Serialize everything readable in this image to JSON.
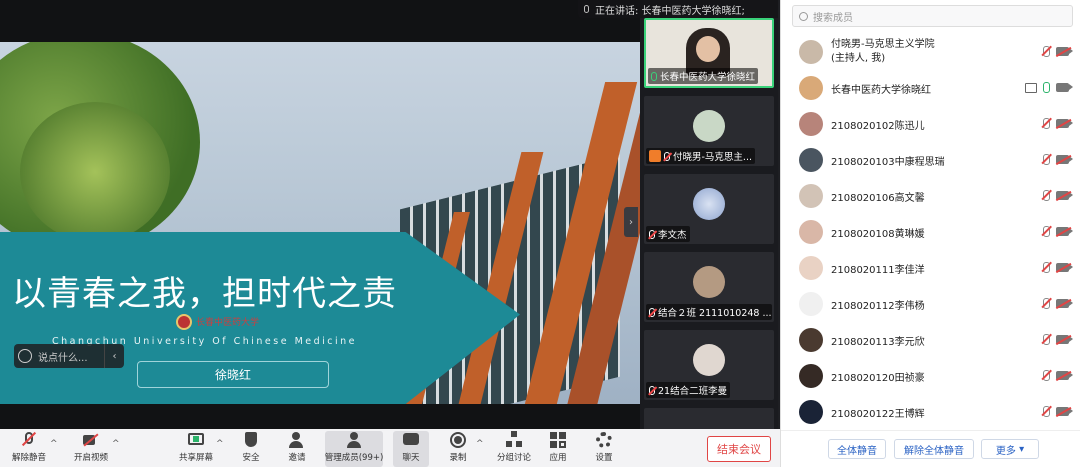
{
  "speaking": {
    "text": "正在讲话: 长春中医药大学徐晓红;"
  },
  "slide": {
    "title": "以青春之我，担时代之责",
    "university_cn": "长春中医药大学",
    "university_en": "Changchun University Of Chinese Medicine",
    "name_box": "徐晓红"
  },
  "chat": {
    "placeholder": "说点什么..."
  },
  "video_tiles": [
    {
      "label": "长春中医药大学徐晓红",
      "active": true
    },
    {
      "label": "付晓男-马克思主...",
      "host": true
    },
    {
      "label": "李文杰"
    },
    {
      "label": "结合２班 2111010248 ..."
    },
    {
      "label": "21结合二班李曼"
    }
  ],
  "toolbar": {
    "unmute": "解除静音",
    "start_video": "开启视频",
    "share_screen": "共享屏幕",
    "security": "安全",
    "invite": "邀请",
    "manage_members": "管理成员(99+)",
    "chat": "聊天",
    "record": "录制",
    "breakout": "分组讨论",
    "apps": "应用",
    "settings": "设置",
    "end_meeting": "结束会议"
  },
  "members_panel": {
    "search_placeholder": "搜索成员",
    "members": [
      {
        "name": "付晓男-马克思主义学院",
        "sub": "(主持人, 我)",
        "color": "#c9b9a8"
      },
      {
        "name": "长春中医药大学徐晓红",
        "color": "#d9a978",
        "sharing": true,
        "mic_on": true
      },
      {
        "name": "2108020102陈迅儿",
        "color": "#b7847a"
      },
      {
        "name": "2108020103中康程思瑞",
        "color": "#4a5560"
      },
      {
        "name": "2108020106高文馨",
        "color": "#d2c3b6"
      },
      {
        "name": "2108020108黄琳媛",
        "color": "#d9b7a7"
      },
      {
        "name": "2108020111李佳洋",
        "color": "#e9d2c4"
      },
      {
        "name": "2108020112李伟杨",
        "color": "#f0f0f0"
      },
      {
        "name": "2108020113李元欣",
        "color": "#4a3a30"
      },
      {
        "name": "2108020120田祯豪",
        "color": "#352a25"
      },
      {
        "name": "2108020122王博辉",
        "color": "#1a2336"
      }
    ],
    "mute_all": "全体静音",
    "unmute_all": "解除全体静音",
    "more": "更多"
  }
}
